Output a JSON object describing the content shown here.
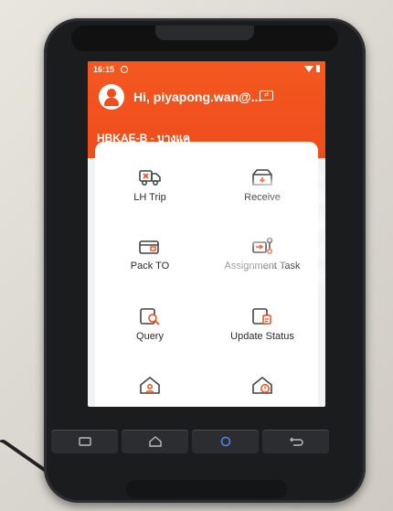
{
  "status_bar": {
    "time": "16:15"
  },
  "header": {
    "greeting": "Hi, piyapong.wan@...",
    "switch_icon_text": "⇄",
    "station": "HBKAE-B - บางแค"
  },
  "menu": {
    "items": [
      {
        "id": "lh-trip",
        "label": "LH Trip",
        "icon": "truck-icon"
      },
      {
        "id": "receive",
        "label": "Receive",
        "icon": "box-receive-icon"
      },
      {
        "id": "pack-to",
        "label": "Pack TO",
        "icon": "pack-box-icon"
      },
      {
        "id": "assignment-task",
        "label": "Assignment Task",
        "icon": "assignment-icon"
      },
      {
        "id": "query",
        "label": "Query",
        "icon": "search-doc-icon"
      },
      {
        "id": "update-status",
        "label": "Update Status",
        "icon": "update-doc-icon"
      },
      {
        "id": "row4-left",
        "label": "",
        "icon": "house-user-icon"
      },
      {
        "id": "row4-right",
        "label": "",
        "icon": "house-alert-icon"
      }
    ]
  },
  "colors": {
    "accent": "#ef4d1c",
    "icon_stroke": "#444444",
    "icon_accent": "#ef4d1c"
  }
}
